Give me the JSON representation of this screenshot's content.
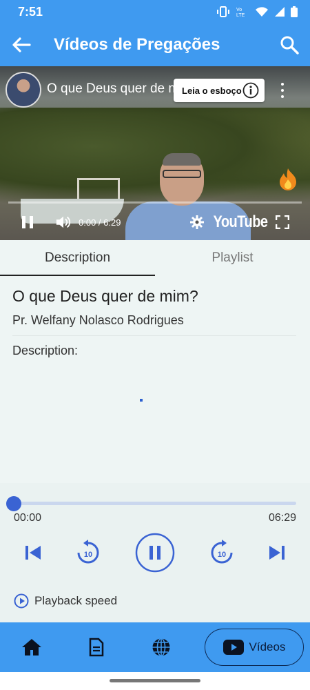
{
  "status_bar": {
    "time": "7:51",
    "icons": [
      "vibrate-icon",
      "volte-icon",
      "wifi-icon",
      "signal-icon",
      "battery-icon"
    ],
    "volte_text": "Vo LTE"
  },
  "app_bar": {
    "title": "Vídeos de Pregações",
    "back_icon": "arrow-left-icon",
    "search_icon": "search-icon"
  },
  "video": {
    "title": "O que Deus quer de mim?",
    "esboco_label": "Leia o esboço",
    "time_display": "0:00 / 6:29",
    "logo": "YouTube"
  },
  "tabs": [
    {
      "label": "Description",
      "active": true
    },
    {
      "label": "Playlist",
      "active": false
    }
  ],
  "description": {
    "title": "O que Deus quer de mim?",
    "preacher": "Pr. Welfany Nolasco Rodrigues",
    "label": "Description:"
  },
  "player": {
    "current_time": "00:00",
    "total_time": "06:29",
    "progress": 0,
    "rewind_seconds": "10",
    "forward_seconds": "10",
    "playback_speed_label": "Playback speed"
  },
  "bottom_nav": {
    "items": [
      "home-icon",
      "document-icon",
      "globe-icon"
    ],
    "active_label": "Vídeos"
  },
  "colors": {
    "primary": "#3f9af0",
    "accent": "#3a63d3",
    "background": "#eef5f4"
  }
}
